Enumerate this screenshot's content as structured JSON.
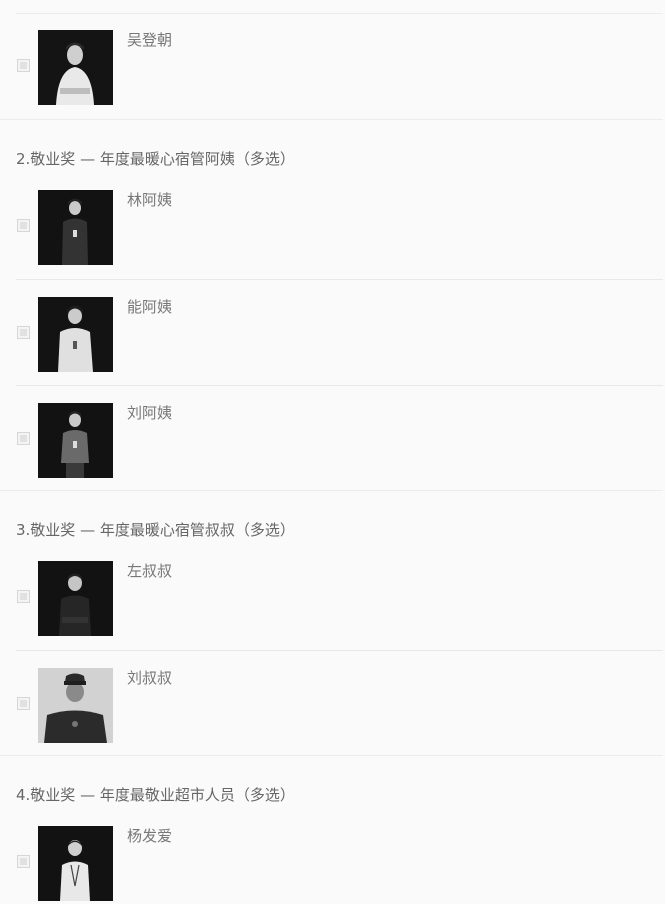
{
  "questions": [
    {
      "title": "",
      "options": [
        {
          "name": "吴登朝"
        }
      ]
    },
    {
      "title": "2.敬业奖 — 年度最暖心宿管阿姨（多选）",
      "options": [
        {
          "name": "林阿姨"
        },
        {
          "name": "能阿姨"
        },
        {
          "name": "刘阿姨"
        }
      ]
    },
    {
      "title": "3.敬业奖 — 年度最暖心宿管叔叔（多选）",
      "options": [
        {
          "name": "左叔叔"
        },
        {
          "name": "刘叔叔"
        }
      ]
    },
    {
      "title": "4.敬业奖 — 年度最敬业超市人员（多选）",
      "options": [
        {
          "name": "杨发爱"
        }
      ]
    }
  ]
}
